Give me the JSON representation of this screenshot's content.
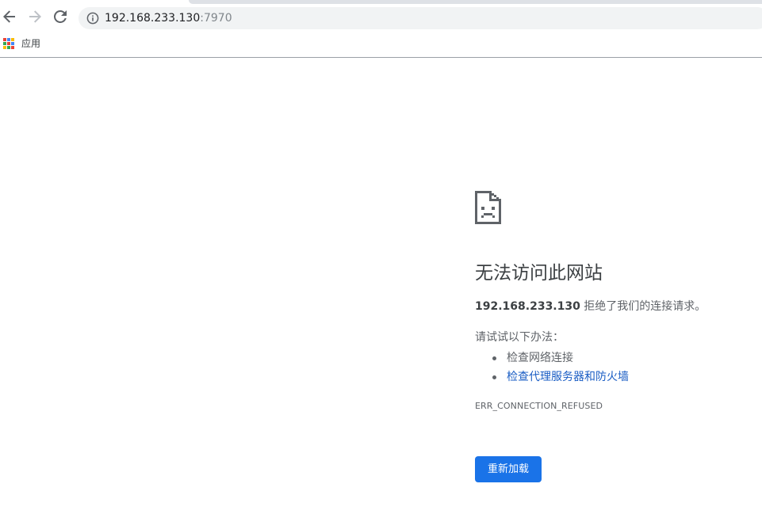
{
  "browser": {
    "address_bar": {
      "host": "192.168.233.130",
      "port": ":7970",
      "info_icon": "info-circle-icon"
    },
    "nav": {
      "back_icon": "arrow-left-icon",
      "forward_icon": "arrow-right-icon",
      "reload_icon": "reload-icon"
    },
    "bookmarks_bar": {
      "apps_label": "应用",
      "apps_icon": "apps-grid-icon",
      "apps_colors": [
        "#ea4335",
        "#4285f4",
        "#fbbc05",
        "#34a853",
        "#ea4335",
        "#4285f4",
        "#fbbc05",
        "#34a853",
        "#ea4335"
      ]
    }
  },
  "error_page": {
    "icon": "sad-page-icon",
    "title": "无法访问此网站",
    "summary_host": "192.168.233.130",
    "summary_text": " 拒绝了我们的连接请求。",
    "suggestions_heading": "请试试以下办法：",
    "suggestions": [
      {
        "text": "检查网络连接",
        "is_link": false
      },
      {
        "text": "检查代理服务器和防火墙",
        "is_link": true
      }
    ],
    "error_code": "ERR_CONNECTION_REFUSED",
    "reload_button_label": "重新加载",
    "accent_color": "#1a73e8",
    "link_color": "#1a5dc4"
  }
}
